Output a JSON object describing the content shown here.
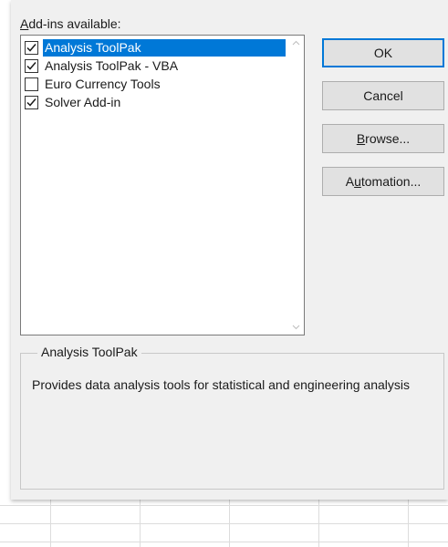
{
  "dialog": {
    "available_label_prefix": "A",
    "available_label_rest": "dd-ins available:",
    "addins": [
      {
        "label": "Analysis ToolPak",
        "checked": true,
        "selected": true
      },
      {
        "label": "Analysis ToolPak - VBA",
        "checked": true,
        "selected": false
      },
      {
        "label": "Euro Currency Tools",
        "checked": false,
        "selected": false
      },
      {
        "label": "Solver Add-in",
        "checked": true,
        "selected": false
      }
    ],
    "buttons": {
      "ok": "OK",
      "cancel": "Cancel",
      "browse_mnemonic": "B",
      "browse_rest": "rowse...",
      "automation_pre": "A",
      "automation_mnemonic": "u",
      "automation_rest": "tomation..."
    },
    "description": {
      "title": "Analysis ToolPak",
      "text": "Provides data analysis tools for statistical and engineering analysis"
    }
  },
  "colors": {
    "selection": "#0078d7",
    "dialog_bg": "#f0f0f0",
    "default_button_border": "#0078d7"
  },
  "icons": {
    "check": "check-icon",
    "scroll_up": "chevron-up-icon",
    "scroll_down": "chevron-down-icon"
  }
}
